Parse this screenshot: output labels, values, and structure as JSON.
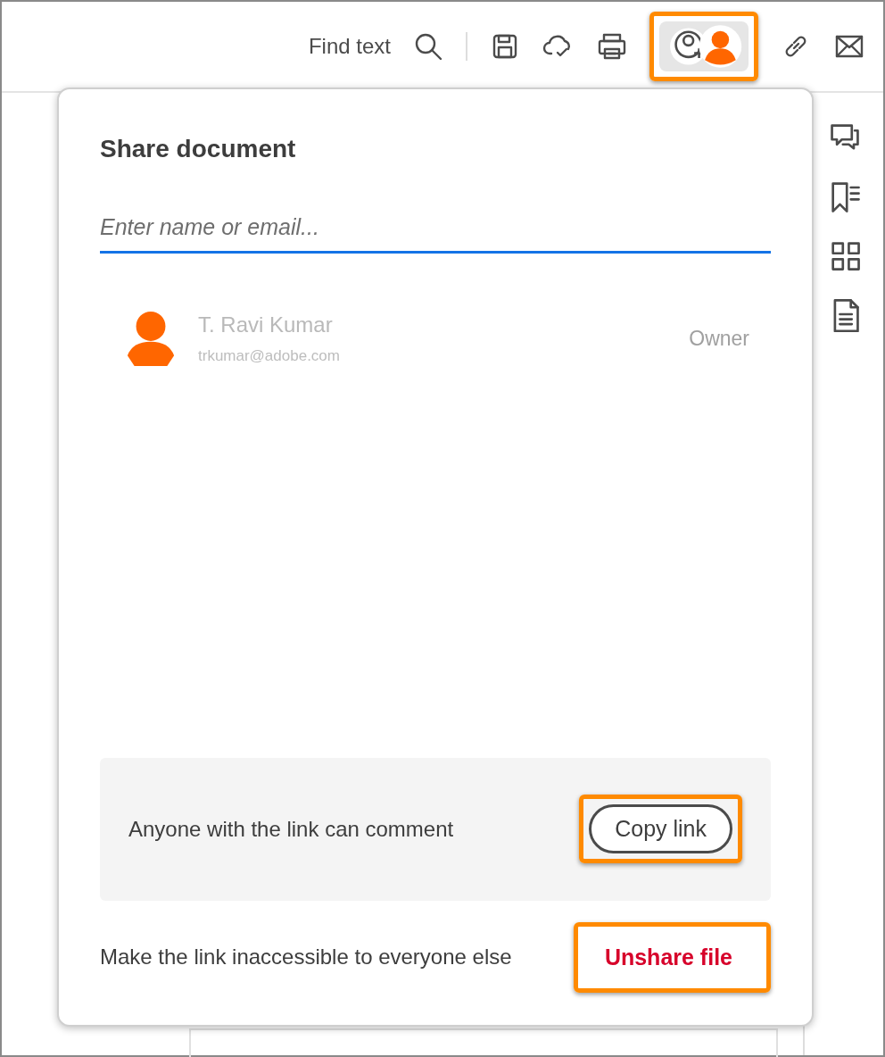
{
  "toolbar": {
    "find_label": "Find text",
    "tools": [
      {
        "kind": "save",
        "highlighted": false
      },
      {
        "kind": "cloud",
        "highlighted": false
      },
      {
        "kind": "print",
        "highlighted": false
      },
      {
        "kind": "share",
        "highlighted": true,
        "selected": true
      },
      {
        "kind": "link",
        "highlighted": false
      },
      {
        "kind": "mail",
        "highlighted": false
      }
    ]
  },
  "sidebar": {
    "tools": [
      {
        "kind": "comment"
      },
      {
        "kind": "bookmark"
      },
      {
        "kind": "grid"
      },
      {
        "kind": "document"
      }
    ]
  },
  "share_panel": {
    "title": "Share document",
    "input": {
      "placeholder": "Enter name or email..."
    },
    "people": [
      {
        "name": "T. Ravi Kumar",
        "email": "trkumar@adobe.com",
        "role": "Owner"
      }
    ],
    "link_box": {
      "text": "Anyone with the link can comment",
      "button": "Copy link",
      "highlighted": true
    },
    "unshare": {
      "text": "Make the link inaccessible to everyone else",
      "button": "Unshare file",
      "highlighted": true
    }
  }
}
